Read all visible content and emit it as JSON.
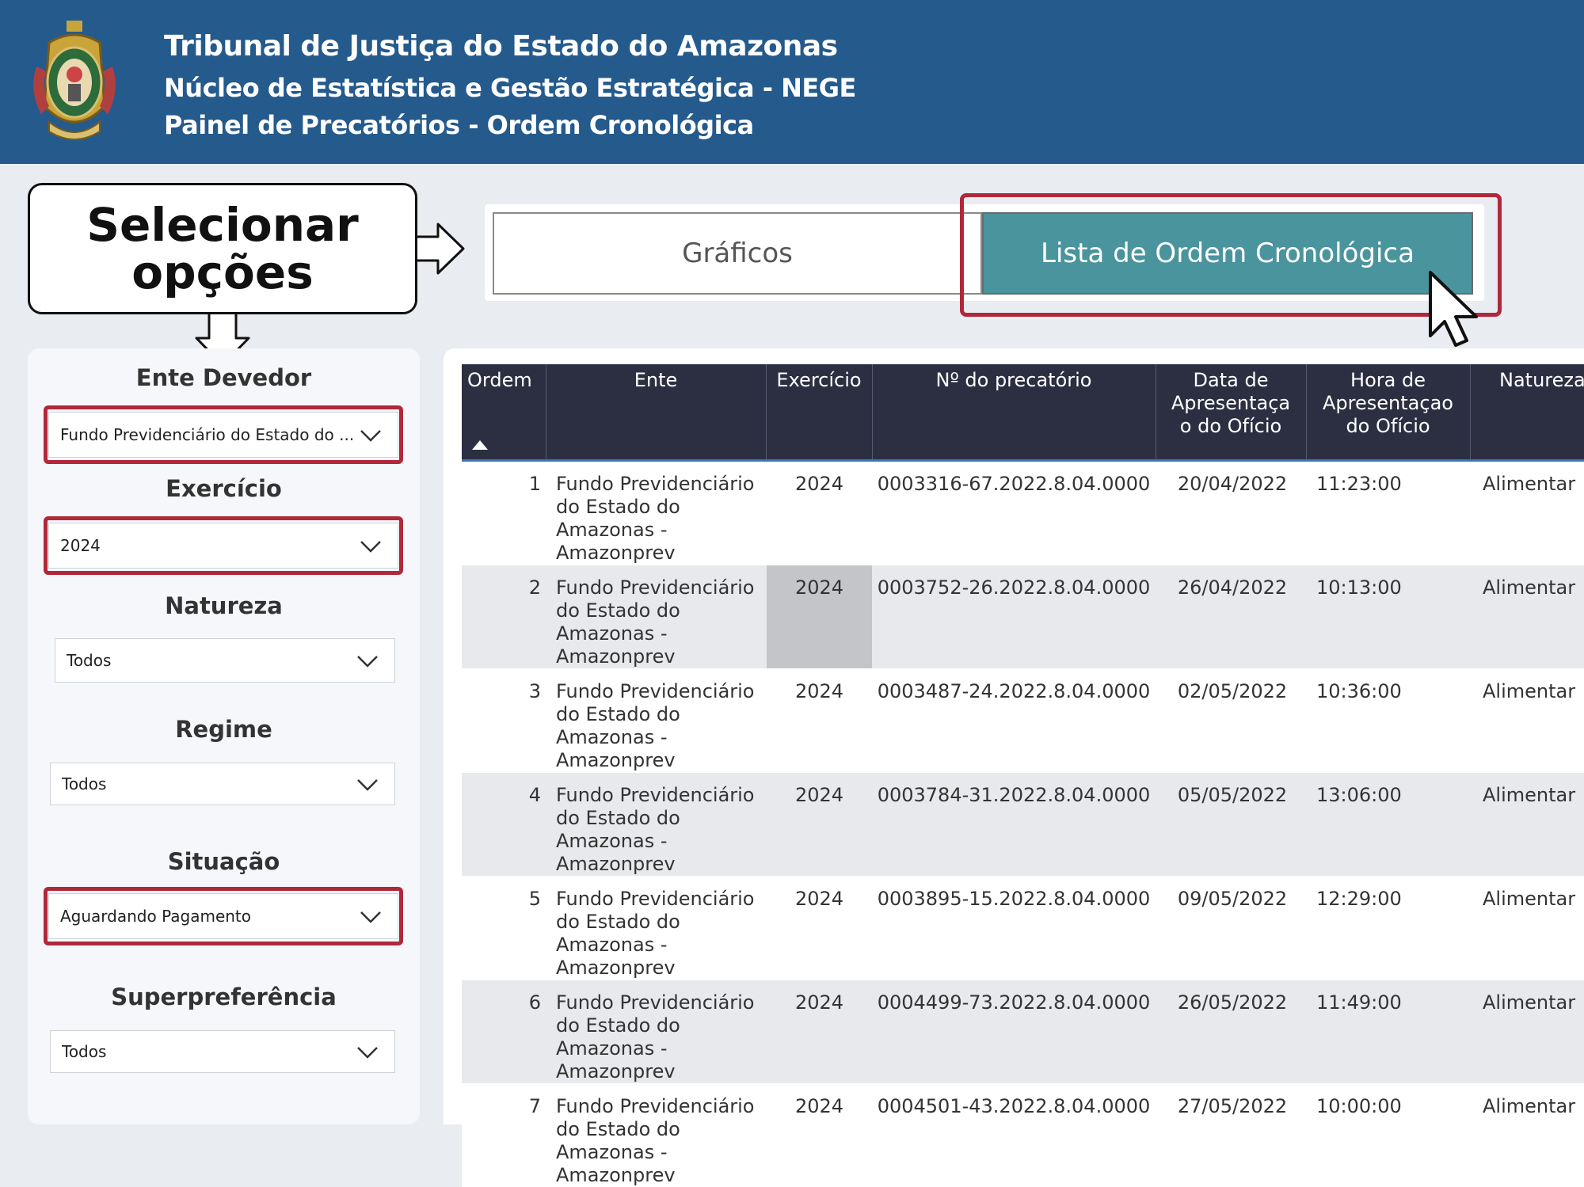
{
  "header": {
    "title": "Tribunal de Justiça do Estado do Amazonas",
    "subtitle1": "Núcleo de Estatística e Gestão Estratégica - NEGE",
    "subtitle2": "Painel de Precatórios - Ordem Cronológica"
  },
  "callout": {
    "line1": "Selecionar",
    "line2": "opções"
  },
  "tabs": {
    "graficos": "Gráficos",
    "lista": "Lista de Ordem Cronológica"
  },
  "filters": {
    "ente_label": "Ente Devedor",
    "ente_value": "Fundo Previdenciário do Estado do ...",
    "exercicio_label": "Exercício",
    "exercicio_value": "2024",
    "natureza_label": "Natureza",
    "natureza_value": "Todos",
    "regime_label": "Regime",
    "regime_value": "Todos",
    "situacao_label": "Situação",
    "situacao_value": "Aguardando Pagamento",
    "super_label": "Superpreferência",
    "super_value": "Todos"
  },
  "table": {
    "headers": {
      "ordem": "Ordem",
      "ente": "Ente",
      "exercicio": "Exercício",
      "numero": "Nº do precatório",
      "data_l1": "Data de",
      "data_l2": "Apresentaça",
      "data_l3": "o do Ofício",
      "hora_l1": "Hora de",
      "hora_l2": "Apresentaçao",
      "hora_l3": "do Ofício",
      "natureza": "Natureza"
    },
    "rows": [
      {
        "ordem": "1",
        "ente": "Fundo Previdenciário do Estado do Amazonas - Amazonprev",
        "exercicio": "2024",
        "numero": "0003316-67.2022.8.04.0000",
        "data": "20/04/2022",
        "hora": "11:23:00",
        "natureza": "Alimentar"
      },
      {
        "ordem": "2",
        "ente": "Fundo Previdenciário do Estado do Amazonas - Amazonprev",
        "exercicio": "2024",
        "numero": "0003752-26.2022.8.04.0000",
        "data": "26/04/2022",
        "hora": "10:13:00",
        "natureza": "Alimentar"
      },
      {
        "ordem": "3",
        "ente": "Fundo Previdenciário do Estado do Amazonas - Amazonprev",
        "exercicio": "2024",
        "numero": "0003487-24.2022.8.04.0000",
        "data": "02/05/2022",
        "hora": "10:36:00",
        "natureza": "Alimentar"
      },
      {
        "ordem": "4",
        "ente": "Fundo Previdenciário do Estado do Amazonas - Amazonprev",
        "exercicio": "2024",
        "numero": "0003784-31.2022.8.04.0000",
        "data": "05/05/2022",
        "hora": "13:06:00",
        "natureza": "Alimentar"
      },
      {
        "ordem": "5",
        "ente": "Fundo Previdenciário do Estado do Amazonas - Amazonprev",
        "exercicio": "2024",
        "numero": "0003895-15.2022.8.04.0000",
        "data": "09/05/2022",
        "hora": "12:29:00",
        "natureza": "Alimentar"
      },
      {
        "ordem": "6",
        "ente": "Fundo Previdenciário do Estado do Amazonas - Amazonprev",
        "exercicio": "2024",
        "numero": "0004499-73.2022.8.04.0000",
        "data": "26/05/2022",
        "hora": "11:49:00",
        "natureza": "Alimentar"
      },
      {
        "ordem": "7",
        "ente": "Fundo Previdenciário do Estado do Amazonas - Amazonprev",
        "exercicio": "2024",
        "numero": "0004501-43.2022.8.04.0000",
        "data": "27/05/2022",
        "hora": "10:00:00",
        "natureza": "Alimentar"
      }
    ]
  },
  "colors": {
    "header_bg": "#245a8c",
    "accent_teal": "#4a949e",
    "highlight_red": "#b0283a",
    "table_header_bg": "#2c2f41"
  }
}
